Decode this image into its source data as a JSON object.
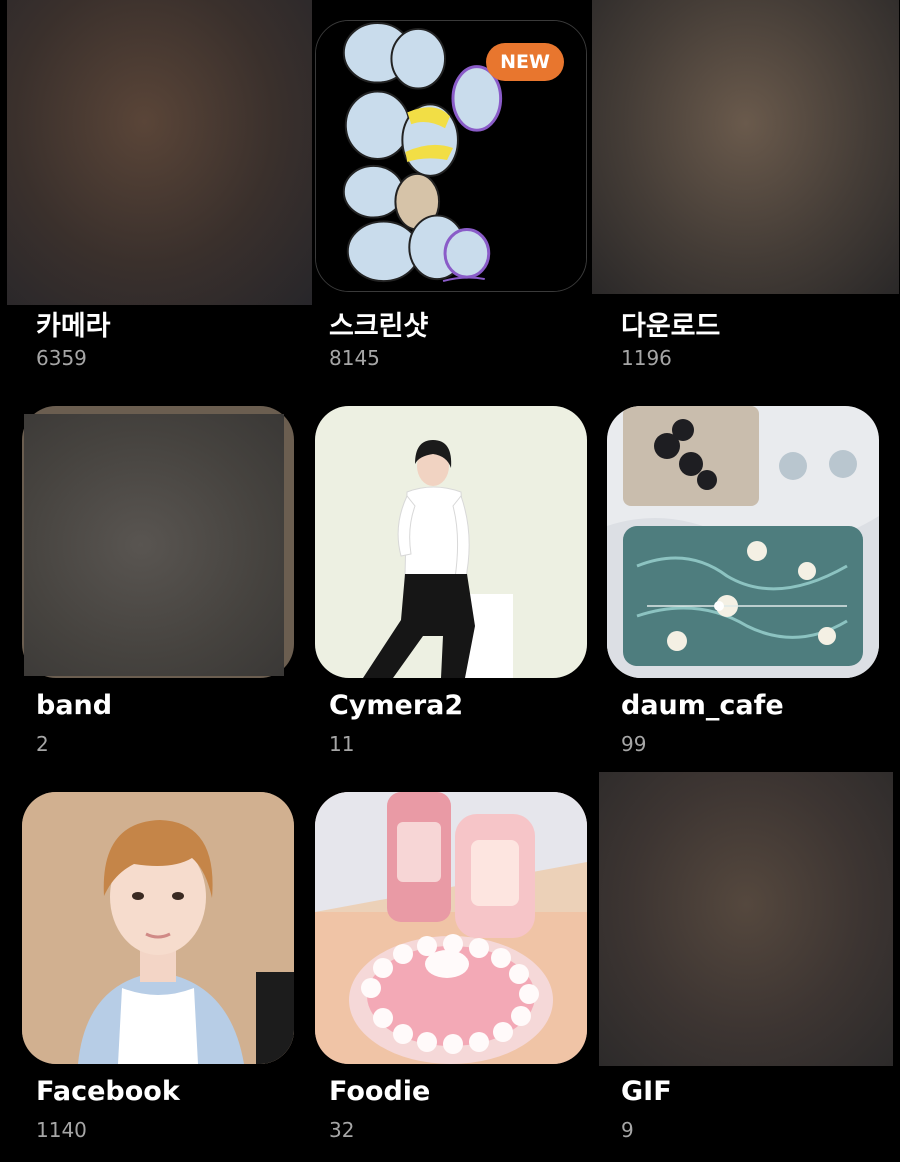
{
  "albums": [
    {
      "name": "카메라",
      "count": "6359"
    },
    {
      "name": "스크린샷",
      "count": "8145",
      "badge": "NEW"
    },
    {
      "name": "다운로드",
      "count": "1196"
    },
    {
      "name": "band",
      "count": "2"
    },
    {
      "name": "Cymera2",
      "count": "11"
    },
    {
      "name": "daum_cafe",
      "count": "99"
    },
    {
      "name": "Facebook",
      "count": "1140"
    },
    {
      "name": "Foodie",
      "count": "32"
    },
    {
      "name": "GIF",
      "count": "9"
    }
  ],
  "colors": {
    "background": "#000000",
    "badge": "#e8762e",
    "count_text": "#a6a6a6"
  }
}
